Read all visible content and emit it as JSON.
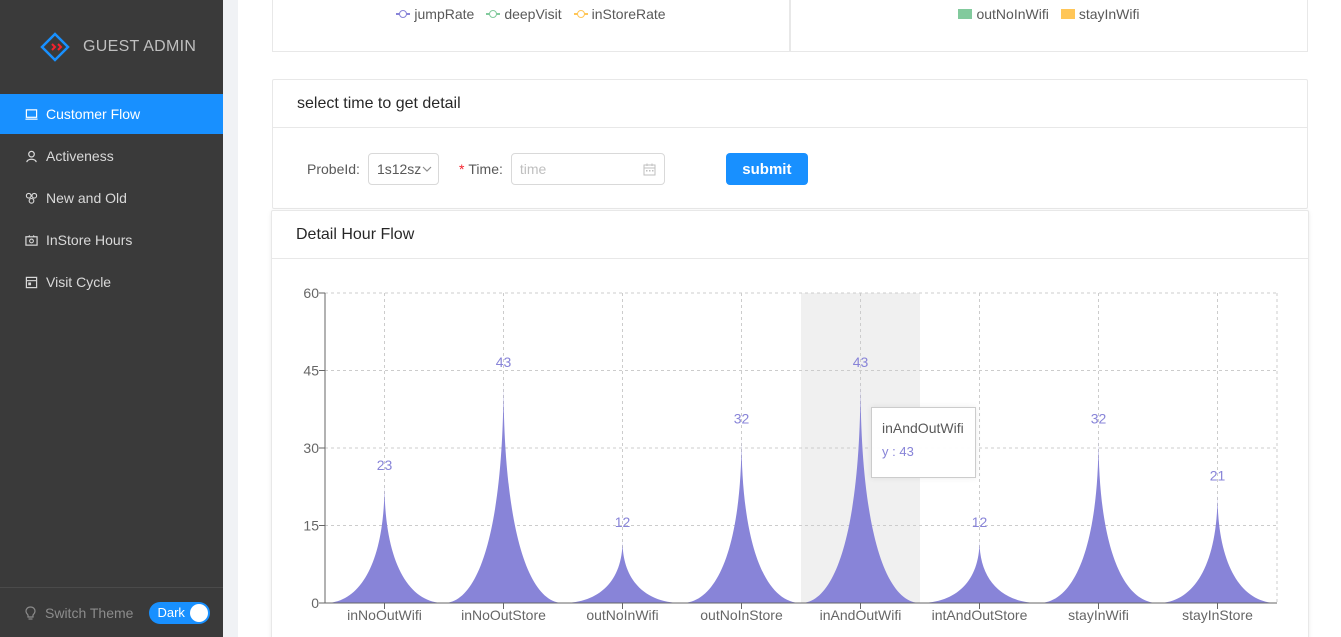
{
  "app": {
    "title": "GUEST ADMIN"
  },
  "sidebar": {
    "items": [
      {
        "label": "Customer Flow",
        "icon": "laptop-icon",
        "active": true
      },
      {
        "label": "Activeness",
        "icon": "user-icon",
        "active": false
      },
      {
        "label": "New and Old",
        "icon": "team-icon",
        "active": false
      },
      {
        "label": "InStore Hours",
        "icon": "camera-icon",
        "active": false
      },
      {
        "label": "Visit Cycle",
        "icon": "calendar-icon",
        "active": false
      }
    ],
    "footer": {
      "label": "Switch Theme",
      "switch_label": "Dark"
    }
  },
  "top_legends": {
    "left": [
      {
        "name": "jumpRate",
        "color": "#8884d8"
      },
      {
        "name": "deepVisit",
        "color": "#82ca9d"
      },
      {
        "name": "inStoreRate",
        "color": "#ffc658"
      }
    ],
    "right": [
      {
        "name": "outNoInWifi",
        "color": "#82ca9d"
      },
      {
        "name": "stayInWifi",
        "color": "#ffc658"
      }
    ]
  },
  "filter_card": {
    "title": "select time to get detail",
    "probe_label": "ProbeId",
    "probe_value": "1s12sz",
    "time_label": "Time",
    "time_placeholder": "time",
    "submit_label": "submit"
  },
  "detail_card": {
    "title": "Detail Hour Flow"
  },
  "chart_data": {
    "type": "area",
    "title": "Detail Hour Flow",
    "categories": [
      "inNoOutWifi",
      "inNoOutStore",
      "outNoInWifi",
      "outNoInStore",
      "inAndOutWifi",
      "intAndOutStore",
      "stayInWifi",
      "stayInStore"
    ],
    "values": [
      23,
      43,
      12,
      32,
      43,
      12,
      32,
      21
    ],
    "ylim": [
      0,
      60
    ],
    "yticks": [
      0,
      15,
      30,
      45,
      60
    ],
    "grid": true,
    "color": "#8884d8",
    "highlighted_category": "inAndOutWifi"
  },
  "tooltip": {
    "title": "inAndOutWifi",
    "label": "y : 43"
  }
}
